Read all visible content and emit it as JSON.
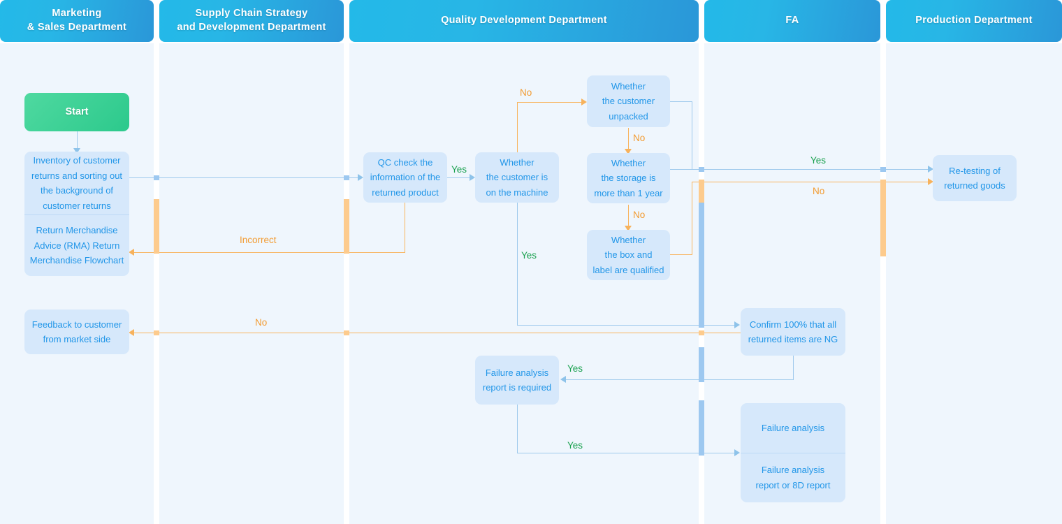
{
  "title": "Return Merchandise Advice (RMA) Return Merchandise Flowchart",
  "colors": {
    "lane_background": "#eff6fd",
    "lane_header_start": "#23b9e8",
    "lane_header_end": "#2a97d8",
    "node_fill": "#d6e8fb",
    "node_text": "#2196e8",
    "start_fill": "#2cc98c",
    "line_blue": "#9ec9ec",
    "line_orange": "#f8b45e",
    "label_yes": "#1aa14f",
    "label_no": "#f29b31"
  },
  "lanes": [
    {
      "id": "marketing",
      "title": "Marketing\n& Sales Department"
    },
    {
      "id": "supply-chain",
      "title": "Supply Chain Strategy\nand Development Department"
    },
    {
      "id": "quality",
      "title": "Quality Development Department"
    },
    {
      "id": "fa",
      "title": "FA"
    },
    {
      "id": "production",
      "title": "Production Department"
    }
  ],
  "lane_titles": {
    "marketing_l1": "Marketing",
    "marketing_l2": "& Sales Department",
    "supply_l1": "Supply Chain Strategy",
    "supply_l2": "and Development Department",
    "quality": "Quality Development Department",
    "fa": "FA",
    "production": "Production Department"
  },
  "nodes": {
    "start": "Start",
    "inventory_l1": "Inventory of customer",
    "inventory_l2": "returns and sorting out",
    "inventory_l3": "the background of",
    "inventory_l4": "customer returns",
    "rma_l1": "Return Merchandise",
    "rma_l2": "Advice (RMA) Return",
    "rma_l3": "Merchandise Flowchart",
    "feedback_l1": "Feedback to customer",
    "feedback_l2": "from market side",
    "qc_l1": "QC check the",
    "qc_l2": "information of the",
    "qc_l3": "returned product",
    "on_machine_l1": "Whether",
    "on_machine_l2": "the customer is",
    "on_machine_l3": "on the machine",
    "unpacked_l1": "Whether",
    "unpacked_l2": "the customer",
    "unpacked_l3": "unpacked",
    "storage_l1": "Whether",
    "storage_l2": "the storage is",
    "storage_l3": "more than 1 year",
    "boxlabel_l1": "Whether",
    "boxlabel_l2": "the box and",
    "boxlabel_l3": "label are qualified",
    "far_required_l1": "Failure analysis",
    "far_required_l2": "report is required",
    "confirm_ng_l1": "Confirm 100% that all",
    "confirm_ng_l2": "returned items are NG",
    "failure_analysis": "Failure analysis",
    "fa_report_l1": "Failure analysis",
    "fa_report_l2": "report or 8D report",
    "retest_l1": "Re-testing of",
    "retest_l2": "returned goods"
  },
  "edge_labels": {
    "qc_yes": "Yes",
    "machine_no": "No",
    "machine_yes": "Yes",
    "unpacked_no": "No",
    "storage_no": "No",
    "incorrect": "Incorrect",
    "feedback_no": "No",
    "retest_yes": "Yes",
    "retest_no": "No",
    "far_yes": "Yes",
    "fa_report_yes": "Yes"
  }
}
